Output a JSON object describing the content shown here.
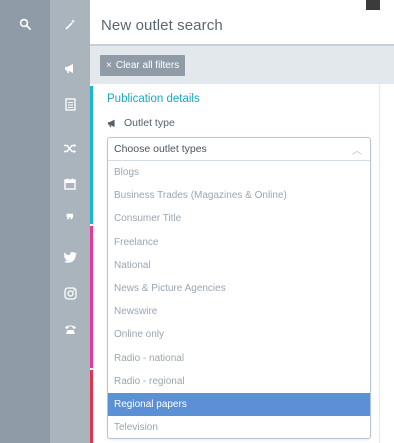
{
  "header": {
    "title": "New outlet search"
  },
  "rail": {
    "outer_icons": [
      "search-icon"
    ],
    "inner_icons": [
      "magic-wand-icon",
      "megaphone-icon",
      "document-icon",
      "shuffle-icon",
      "calendar-icon",
      "quote-icon",
      "twitter-icon",
      "instagram-icon",
      "phone-icon"
    ]
  },
  "filters": {
    "clear_label": "Clear all filters"
  },
  "section": {
    "title": "Publication details",
    "outlet_type_label": "Outlet type"
  },
  "dropdown": {
    "placeholder": "Choose outlet types",
    "options": [
      "Blogs",
      "Business Trades (Magazines & Online)",
      "Consumer Title",
      "Freelance",
      "National",
      "News & Picture Agencies",
      "Newswire",
      "Online only",
      "Radio - national",
      "Radio - regional",
      "Regional papers",
      "Television"
    ],
    "selected": "Regional papers"
  },
  "colors": {
    "teal_accent": "#19b7c7",
    "pink_accent": "#e8379a",
    "red_accent": "#e3344f",
    "selected_bg": "#5b8fd6"
  }
}
